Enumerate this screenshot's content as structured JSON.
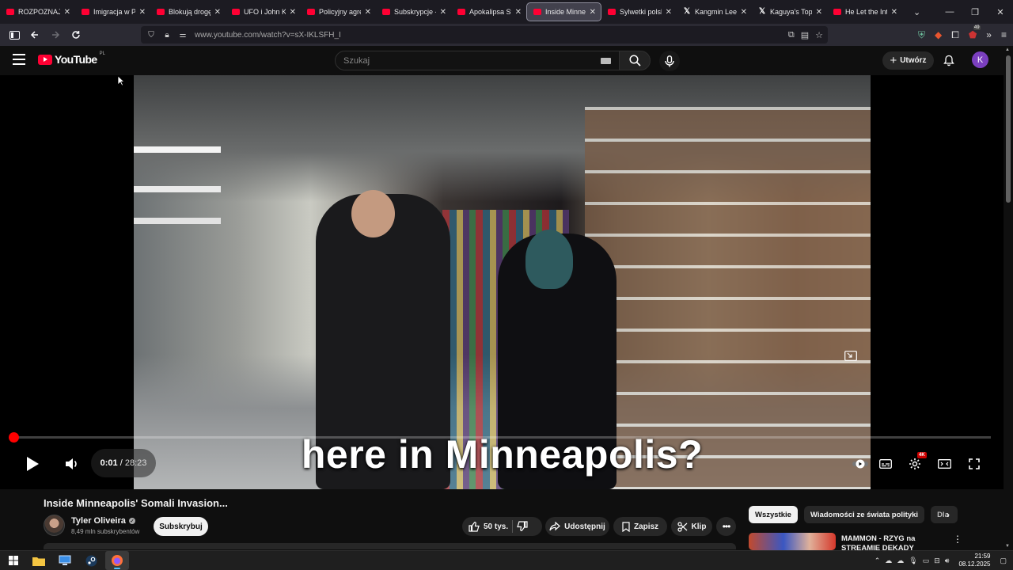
{
  "browser": {
    "tabs": [
      {
        "label": "ROZPOZNAJ KO",
        "icon": "youtube-favicon"
      },
      {
        "label": "Imigracja w Pols",
        "icon": "youtube-favicon"
      },
      {
        "label": "Blokują drogę, z",
        "icon": "youtube-favicon"
      },
      {
        "label": "UFO i John Kenn",
        "icon": "youtube-favicon"
      },
      {
        "label": "Policyjny agresor",
        "icon": "youtube-favicon"
      },
      {
        "label": "Subskrypcje - Yo",
        "icon": "youtube-favicon"
      },
      {
        "label": "Apokalipsa Stali",
        "icon": "youtube-favicon"
      },
      {
        "label": "Inside Minneapo",
        "icon": "youtube-favicon",
        "active": true
      },
      {
        "label": "Sylwetki polskich",
        "icon": "youtube-favicon"
      },
      {
        "label": "Kangmin Lee | P",
        "icon": "x-favicon"
      },
      {
        "label": "Kaguya's Top Gi",
        "icon": "x-favicon"
      },
      {
        "label": "He Let the Intru",
        "icon": "youtube-favicon"
      }
    ],
    "url": "www.youtube.com/watch?v=sX-IKLSFH_I",
    "extension_badge": "49"
  },
  "youtube": {
    "logo_text": "YouTube",
    "country_code": "PL",
    "search_placeholder": "Szukaj",
    "create_label": "Utwórz",
    "avatar_letter": "K"
  },
  "player": {
    "caption": "here in Minneapolis?",
    "time_current": "0:01",
    "time_separator": " / ",
    "time_total": "28:23",
    "progress": 0.0006,
    "quality_badge": "4K"
  },
  "video": {
    "title": "Inside Minneapolis' Somali Invasion...",
    "channel_name": "Tyler Oliveira",
    "subscribers": "8,49 mln subskrybentów",
    "subscribe_label": "Subskrybuj",
    "likes": "50 tys.",
    "share_label": "Udostępnij",
    "save_label": "Zapisz",
    "clip_label": "Klip"
  },
  "sidebar": {
    "chips": [
      "Wszystkie",
      "Wiadomości ze świata polityki",
      "Dla"
    ],
    "rec_title": "MAMMON - RZYG na STREAMIE DEKADY KONIEC"
  },
  "taskbar": {
    "time": "21:59",
    "date": "08.12.2025"
  },
  "colors": {
    "accent_red": "#ff0000",
    "youtube_red": "#ff0033",
    "avatar_purple": "#7b3fbf",
    "background": "#0f0f0f"
  }
}
